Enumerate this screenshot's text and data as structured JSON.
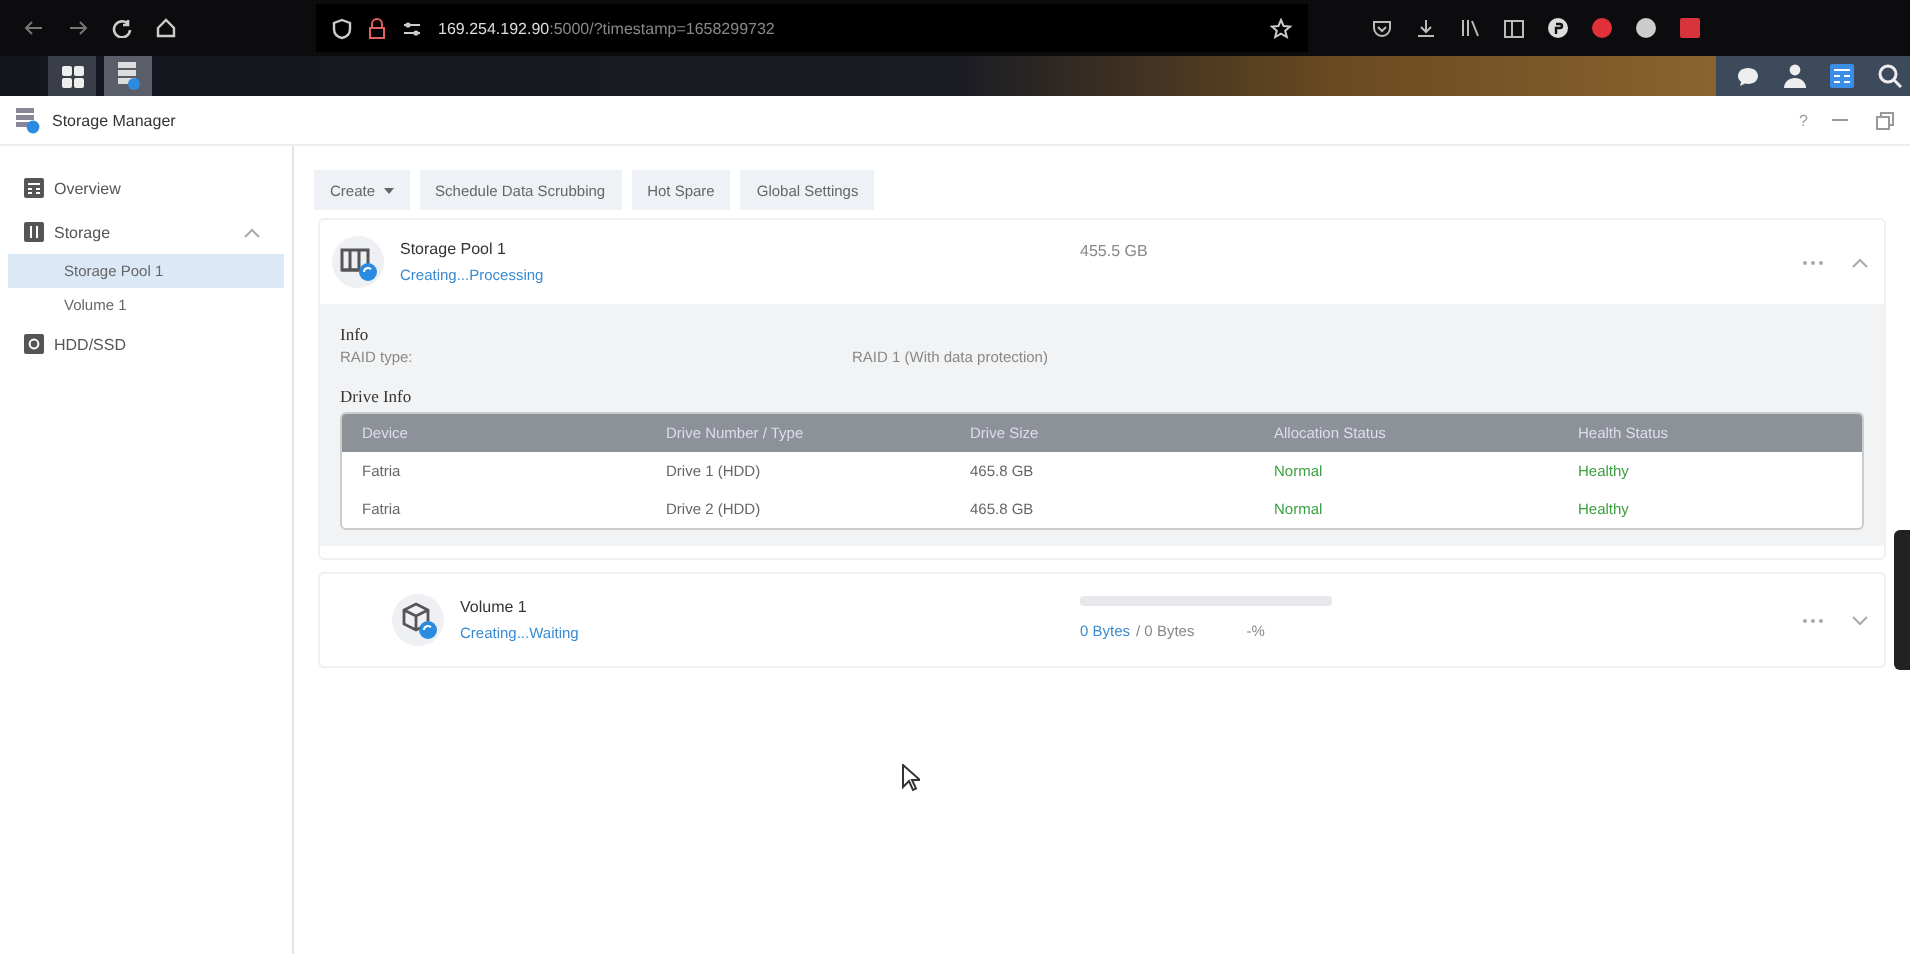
{
  "browser": {
    "url_host": "169.254.192.90",
    "url_rest": ":5000/?timestamp=1658299732"
  },
  "window": {
    "title": "Storage Manager",
    "help": "?"
  },
  "sidebar": {
    "items": [
      {
        "label": "Overview",
        "selected": false,
        "expanded": false
      },
      {
        "label": "Storage",
        "selected": false,
        "expanded": true,
        "children": [
          {
            "label": "Storage Pool 1",
            "selected": true
          },
          {
            "label": "Volume 1",
            "selected": false
          }
        ]
      },
      {
        "label": "HDD/SSD",
        "selected": false,
        "expanded": false
      }
    ]
  },
  "toolbar": [
    {
      "label": "Create",
      "kind": "menu"
    },
    {
      "label": "Schedule Data Scrubbing",
      "kind": "plain"
    },
    {
      "label": "Hot Spare",
      "kind": "plain"
    },
    {
      "label": "Global Settings",
      "kind": "plain"
    }
  ],
  "pool": {
    "name": "Storage Pool 1",
    "status": "Creating...Processing",
    "size": "455.5 GB",
    "expanded": true,
    "info_heading": "Info",
    "info": [
      {
        "label": "RAID type:",
        "value": "RAID 1 (With data protection)"
      }
    ],
    "drive_heading": "Drive Info",
    "columns": [
      {
        "label": "Device",
        "kind": "text"
      },
      {
        "label": "Drive Number / Type",
        "kind": "text"
      },
      {
        "label": "Drive Size",
        "kind": "text"
      },
      {
        "label": "Allocation Status",
        "kind": "status"
      },
      {
        "label": "Health Status",
        "kind": "status"
      }
    ],
    "rows": [
      [
        "Fatria",
        "Drive 1 (HDD)",
        "465.8 GB",
        "Normal",
        "Healthy"
      ],
      [
        "Fatria",
        "Drive 2 (HDD)",
        "465.8 GB",
        "Normal",
        "Healthy"
      ]
    ]
  },
  "volume": {
    "name": "Volume 1",
    "status": "Creating...Waiting",
    "level": 0,
    "used": "0 Bytes",
    "total": "/ 0 Bytes",
    "percent": "-%",
    "expanded": false
  }
}
